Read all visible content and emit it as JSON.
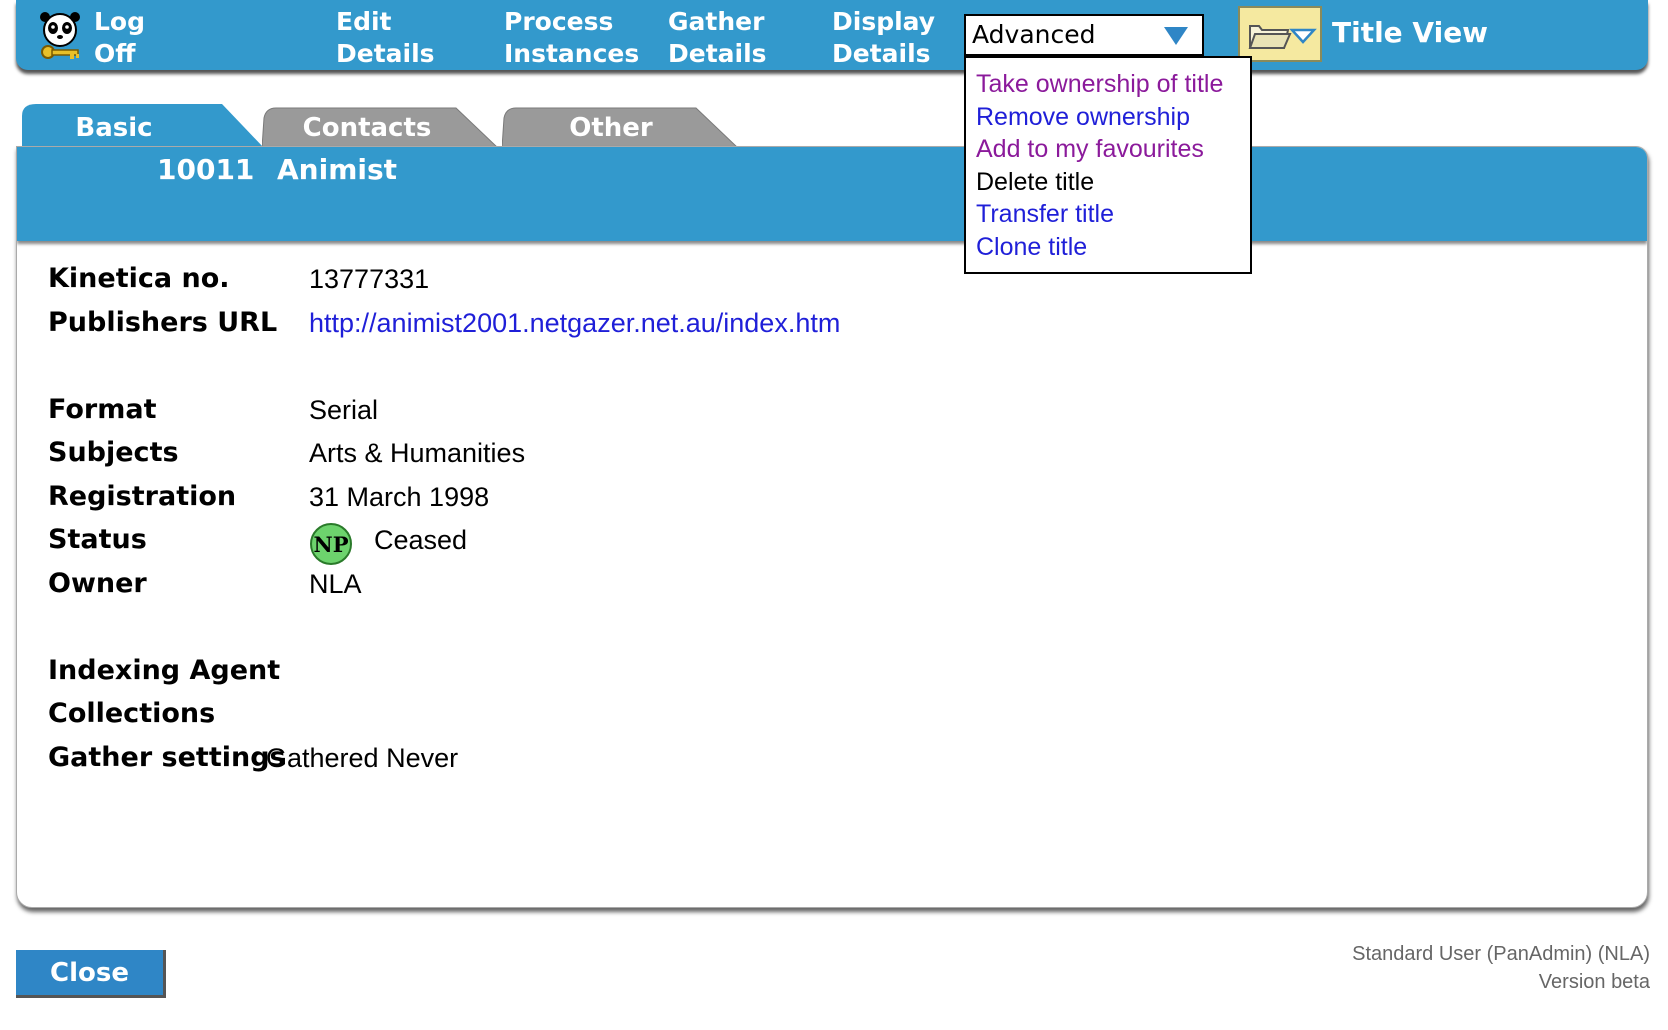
{
  "toolbar": {
    "logoff": [
      "Log",
      "Off"
    ],
    "edit": [
      "Edit",
      "Details"
    ],
    "process": [
      "Process",
      "Instances"
    ],
    "gather": [
      "Gather",
      "Details"
    ],
    "display": [
      "Display",
      "Details"
    ],
    "view_select": "Advanced",
    "title_view": "Title View"
  },
  "dropdown": {
    "items": [
      {
        "label": "Take ownership of title",
        "color": "#8b1a9b"
      },
      {
        "label": "Remove ownership",
        "color": "#1f1fd8"
      },
      {
        "label": "Add to my favourites",
        "color": "#8b1a9b"
      },
      {
        "label": "Delete title",
        "color": "#000000"
      },
      {
        "label": "Transfer title",
        "color": "#1f1fd8"
      },
      {
        "label": "Clone title",
        "color": "#1f1fd8"
      }
    ]
  },
  "tabs": [
    "Basic",
    "Contacts",
    "Other"
  ],
  "title": {
    "id": "10011",
    "name": "Animist"
  },
  "fields": {
    "kinetica_label": "Kinetica no.",
    "kinetica_value": "13777331",
    "url_label": "Publishers URL",
    "url_value": "http://animist2001.netgazer.net.au/index.htm",
    "format_label": "Format",
    "format_value": "Serial",
    "subjects_label": "Subjects",
    "subjects_value": "Arts & Humanities",
    "registration_label": "Registration",
    "registration_value": "31 March 1998",
    "status_label": "Status",
    "status_badge": "NP",
    "status_value": "Ceased",
    "owner_label": "Owner",
    "owner_value": "NLA",
    "indexing_label": "Indexing Agent",
    "collections_label": "Collections",
    "gather_label": "Gather settings",
    "gather_value": "Gathered Never"
  },
  "footer": {
    "close": "Close",
    "user": "Standard User (PanAdmin) (NLA)",
    "version": "Version beta"
  },
  "colors": {
    "accent": "#3399cc",
    "tab_inactive": "#9a9a9a",
    "link": "#1f1fd8",
    "visited": "#8b1a9b"
  }
}
